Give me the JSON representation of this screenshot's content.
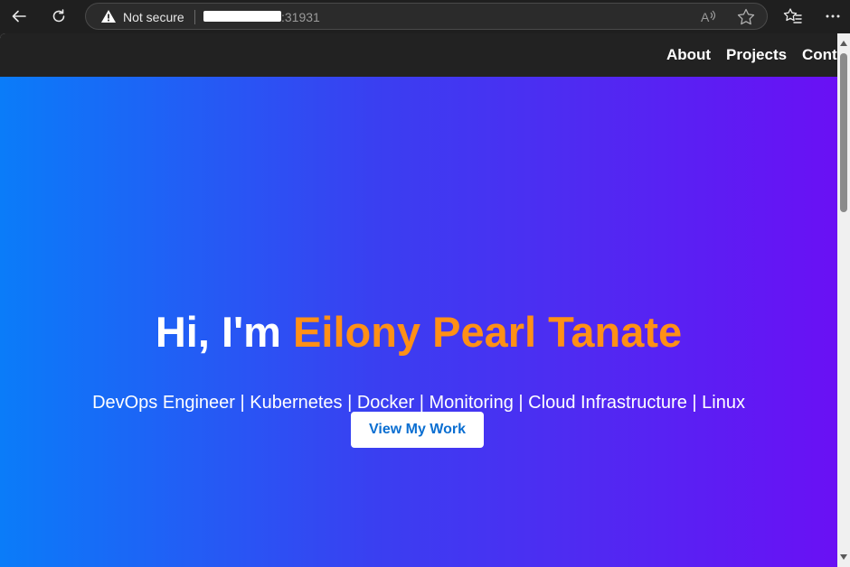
{
  "browser": {
    "security_label": "Not secure",
    "url_visible": ":31931"
  },
  "icons": {
    "back": "arrow-left-icon",
    "refresh": "refresh-icon",
    "warning": "warning-triangle-icon",
    "read_aloud": "read-aloud-icon",
    "favorite": "star-icon",
    "favorites": "favorites-list-icon",
    "more": "more-dots-icon"
  },
  "nav": {
    "about": "About",
    "projects": "Projects",
    "contact": "Conta"
  },
  "hero": {
    "greeting": "Hi, I'm ",
    "name": "Eilony Pearl Tanate",
    "subtitle": "DevOps Engineer | Kubernetes | Docker | Monitoring | Cloud Infrastructure | Linux",
    "cta_label": "View My Work"
  },
  "colors": {
    "nav_background": "#222222",
    "gradient_start": "#0a7cf9",
    "gradient_end": "#6a10f4",
    "name_accent": "#ff9016",
    "cta_text": "#0a6ed1"
  }
}
